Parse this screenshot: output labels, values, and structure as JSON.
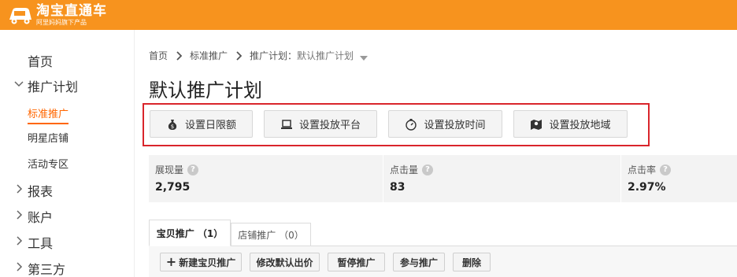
{
  "header": {
    "logo_title": "淘宝直通车",
    "logo_subtitle": "阿里妈妈旗下产品",
    "brand_color": "#f7931e"
  },
  "sidebar": {
    "items": [
      {
        "label": "首页"
      },
      {
        "label": "推广计划",
        "expanded": true
      },
      {
        "label": "报表"
      },
      {
        "label": "账户"
      },
      {
        "label": "工具"
      },
      {
        "label": "第三方"
      }
    ],
    "sub_items": [
      {
        "label": "标准推广",
        "active": true
      },
      {
        "label": "明星店铺"
      },
      {
        "label": "活动专区"
      }
    ]
  },
  "breadcrumb": {
    "home": "首页",
    "level2": "标准推广",
    "plan_prefix": "推广计划：",
    "plan_name": "默认推广计划"
  },
  "page_title": "默认推广计划",
  "settings_buttons": [
    {
      "label": "设置日限额",
      "icon": "money-bag-icon"
    },
    {
      "label": "设置投放平台",
      "icon": "laptop-icon"
    },
    {
      "label": "设置投放时间",
      "icon": "stopwatch-icon"
    },
    {
      "label": "设置投放地域",
      "icon": "map-pin-icon"
    }
  ],
  "stats": [
    {
      "label": "展现量",
      "value": "2,795"
    },
    {
      "label": "点击量",
      "value": "83"
    },
    {
      "label": "点击率",
      "value": "2.97%"
    }
  ],
  "tabs": [
    {
      "label": "宝贝推广 （1）",
      "active": true
    },
    {
      "label": "店铺推广 （0）",
      "active": false
    }
  ],
  "actions": {
    "new_item": "新建宝贝推广",
    "new_item_icon": "plus-icon",
    "modify_bid": "修改默认出价",
    "pause": "暂停推广",
    "join": "参与推广",
    "delete": "删除"
  },
  "colors": {
    "highlight": "#d9252b",
    "active_link": "#ff6600"
  }
}
